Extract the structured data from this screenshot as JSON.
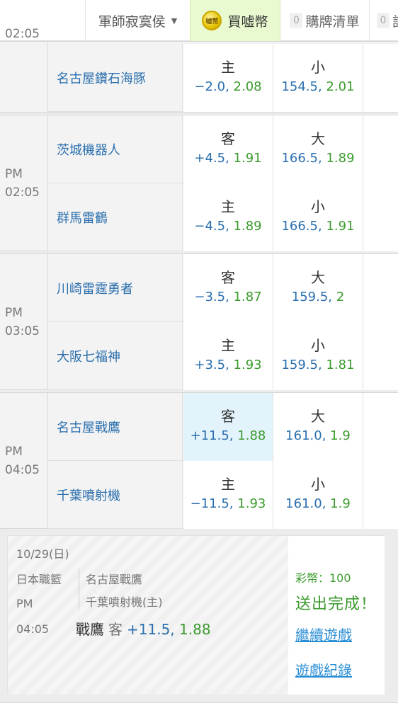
{
  "topbar": {
    "user_label": "軍師寂寞侯",
    "buy_label": "買嘘幣",
    "coin_text": "嘘幣",
    "cart_count": "0",
    "cart_label": "購牌清單",
    "records_count": "0",
    "records_label": "記"
  },
  "blocks": [
    {
      "ampm": "",
      "time": "02:05",
      "rows": [
        {
          "team": "名古屋鑽石海豚",
          "spread_pick": "主",
          "spread_line": "−2.0,",
          "spread_odds": "2.08",
          "total_pick": "小",
          "total_line": "154.5,",
          "total_odds": "2.01"
        }
      ]
    },
    {
      "ampm": "PM",
      "time": "02:05",
      "rows": [
        {
          "team": "茨城機器人",
          "spread_pick": "客",
          "spread_line": "+4.5,",
          "spread_odds": "1.91",
          "total_pick": "大",
          "total_line": "166.5,",
          "total_odds": "1.89"
        },
        {
          "team": "群馬雷鶴",
          "spread_pick": "主",
          "spread_line": "−4.5,",
          "spread_odds": "1.89",
          "total_pick": "小",
          "total_line": "166.5,",
          "total_odds": "1.91"
        }
      ]
    },
    {
      "ampm": "PM",
      "time": "03:05",
      "rows": [
        {
          "team": "川崎雷霆勇者",
          "spread_pick": "客",
          "spread_line": "−3.5,",
          "spread_odds": "1.87",
          "total_pick": "大",
          "total_line": "159.5,",
          "total_odds": "2"
        },
        {
          "team": "大阪七福神",
          "spread_pick": "主",
          "spread_line": "+3.5,",
          "spread_odds": "1.93",
          "total_pick": "小",
          "total_line": "159.5,",
          "total_odds": "1.81"
        }
      ]
    },
    {
      "ampm": "PM",
      "time": "04:05",
      "rows": [
        {
          "team": "名古屋戰鷹",
          "spread_pick": "客",
          "spread_line": "+11.5,",
          "spread_odds": "1.88",
          "total_pick": "大",
          "total_line": "161.0,",
          "total_odds": "1.9"
        },
        {
          "team": "千葉噴射機",
          "spread_pick": "主",
          "spread_line": "−11.5,",
          "spread_odds": "1.93",
          "total_pick": "小",
          "total_line": "161.0,",
          "total_odds": "1.9"
        }
      ]
    }
  ],
  "confirmation": {
    "date": "10/29(日)",
    "league": "日本職籃",
    "team1": "名古屋戰鷹",
    "team2": "千葉噴射機(主)",
    "ampm": "PM",
    "time": "04:05",
    "bet_team": "戰鷹",
    "bet_side": "客",
    "bet_line": "+11.5,",
    "bet_odds": "1.88",
    "coins": "彩幣：100",
    "done": "送出完成！",
    "continue_link": "繼續遊戲",
    "history_link": "遊戲紀錄"
  },
  "colors": {
    "team_blue": "#2b6fae",
    "odds_green": "#3c9b2e",
    "selected_bg": "#e3f3fb",
    "buy_bg": "#eafad0",
    "link_blue": "#2b8fd6"
  }
}
